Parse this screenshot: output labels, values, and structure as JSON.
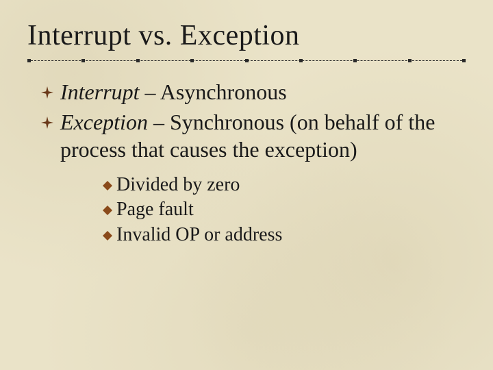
{
  "slide": {
    "title": "Interrupt vs. Exception",
    "bullets": [
      {
        "term": "Interrupt",
        "rest": " – Asynchronous"
      },
      {
        "term": "Exception",
        "rest": " – Synchronous (on behalf of the process that causes the exception)"
      }
    ],
    "sub_bullets": [
      {
        "text": "Divided by zero"
      },
      {
        "text": "Page fault"
      },
      {
        "text": "Invalid OP or address"
      }
    ]
  }
}
